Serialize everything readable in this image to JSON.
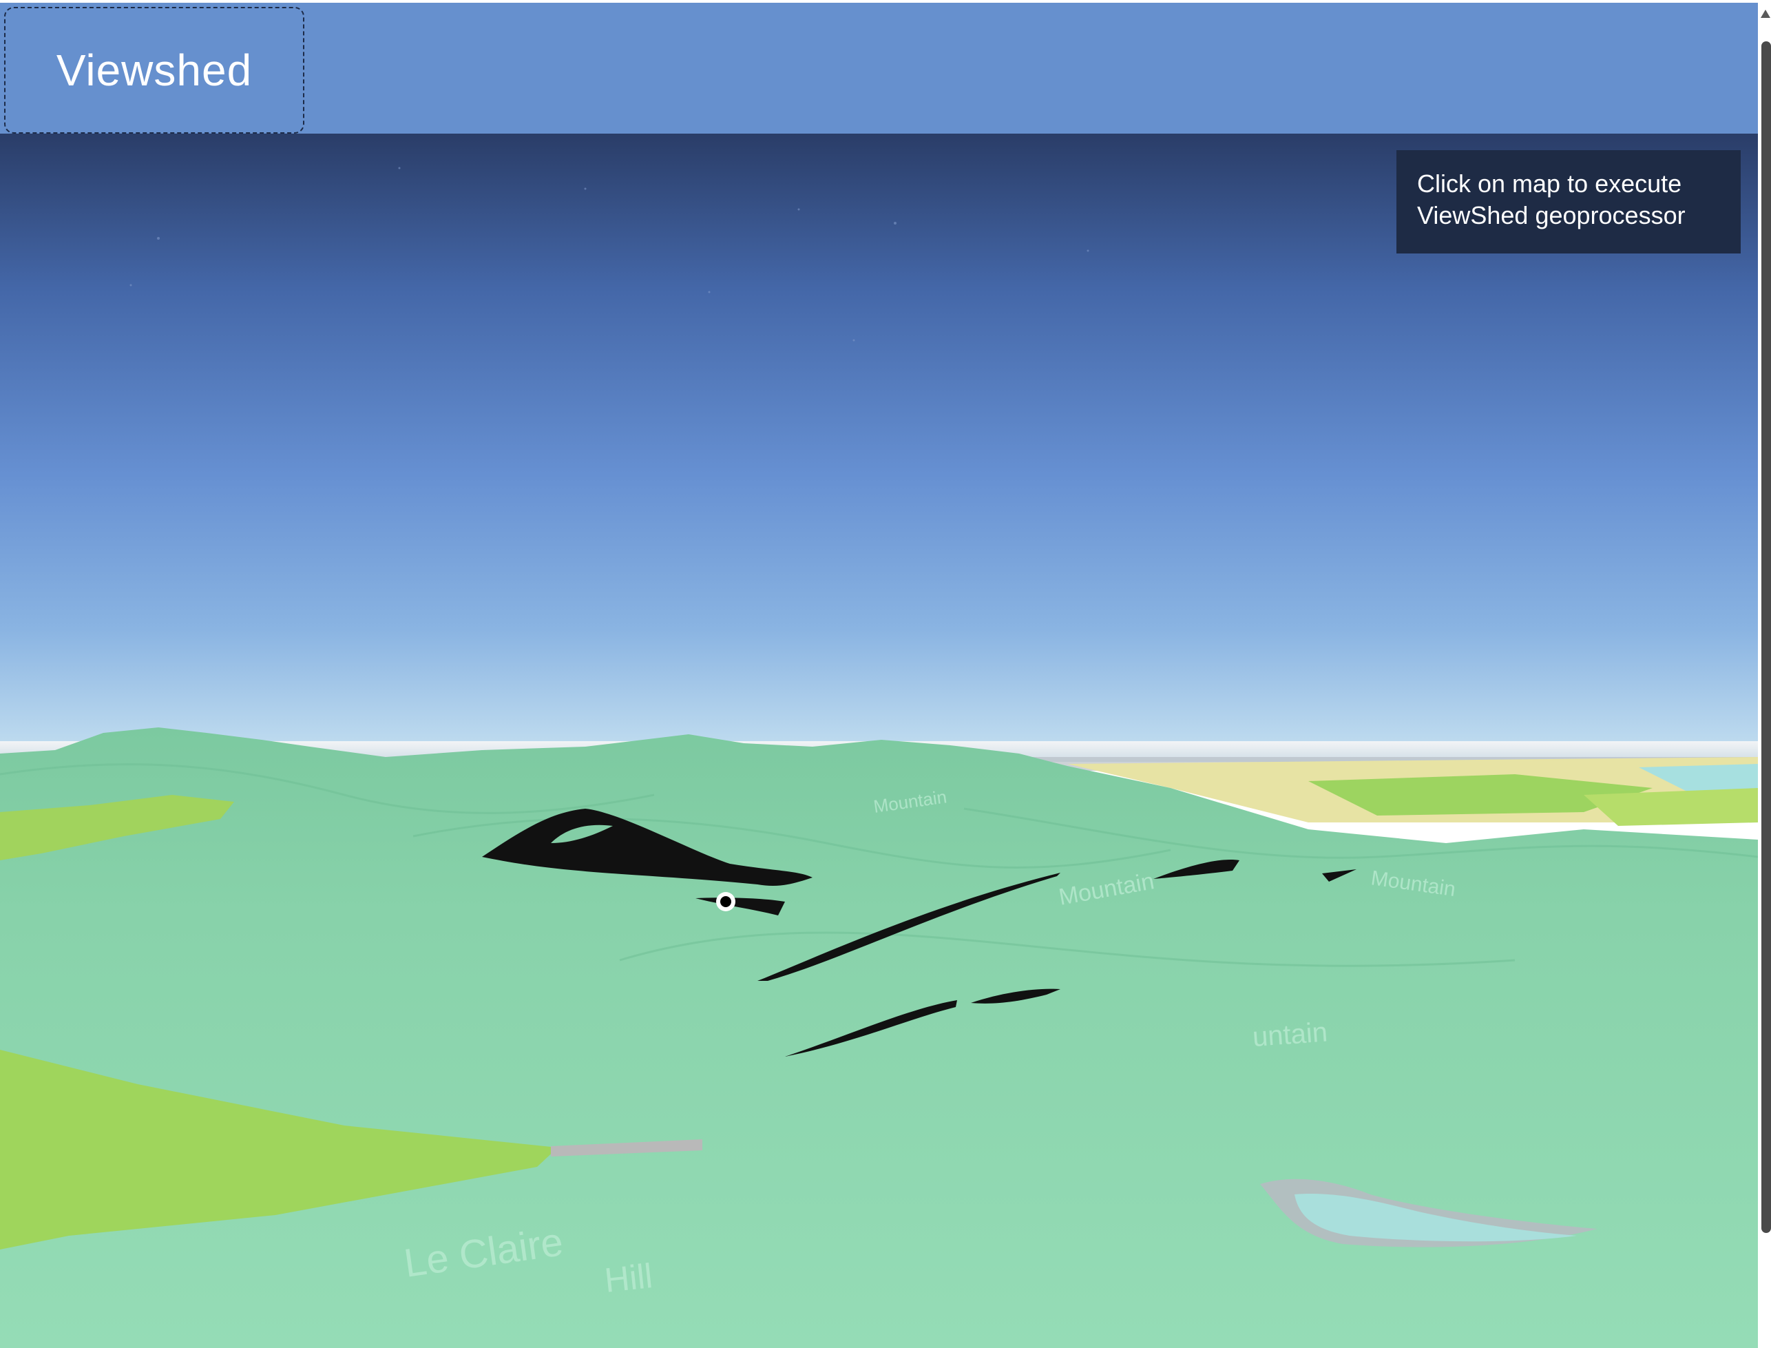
{
  "header": {
    "title": "Viewshed"
  },
  "instruction": {
    "text": "Click on map to execute\nViewShed geoprocessor"
  },
  "map": {
    "terrain_labels": [
      "Mountain",
      "Mountain",
      "Mountain",
      "untain",
      "Le Claire",
      "Hill"
    ],
    "colors": {
      "sky_top": "#2b3f6a",
      "sky_horizon": "#b9d8ee",
      "terrain_base": "#8fd6b2",
      "terrain_ridge": "#7fcaa4",
      "yellow_green_area": "#9dd460",
      "viewshed_fill": "#111111",
      "observer_point": "#000000"
    }
  },
  "colors": {
    "header_bg": "#6690ce",
    "panel_bg": "#1e2b45",
    "panel_text": "#ffffff"
  }
}
